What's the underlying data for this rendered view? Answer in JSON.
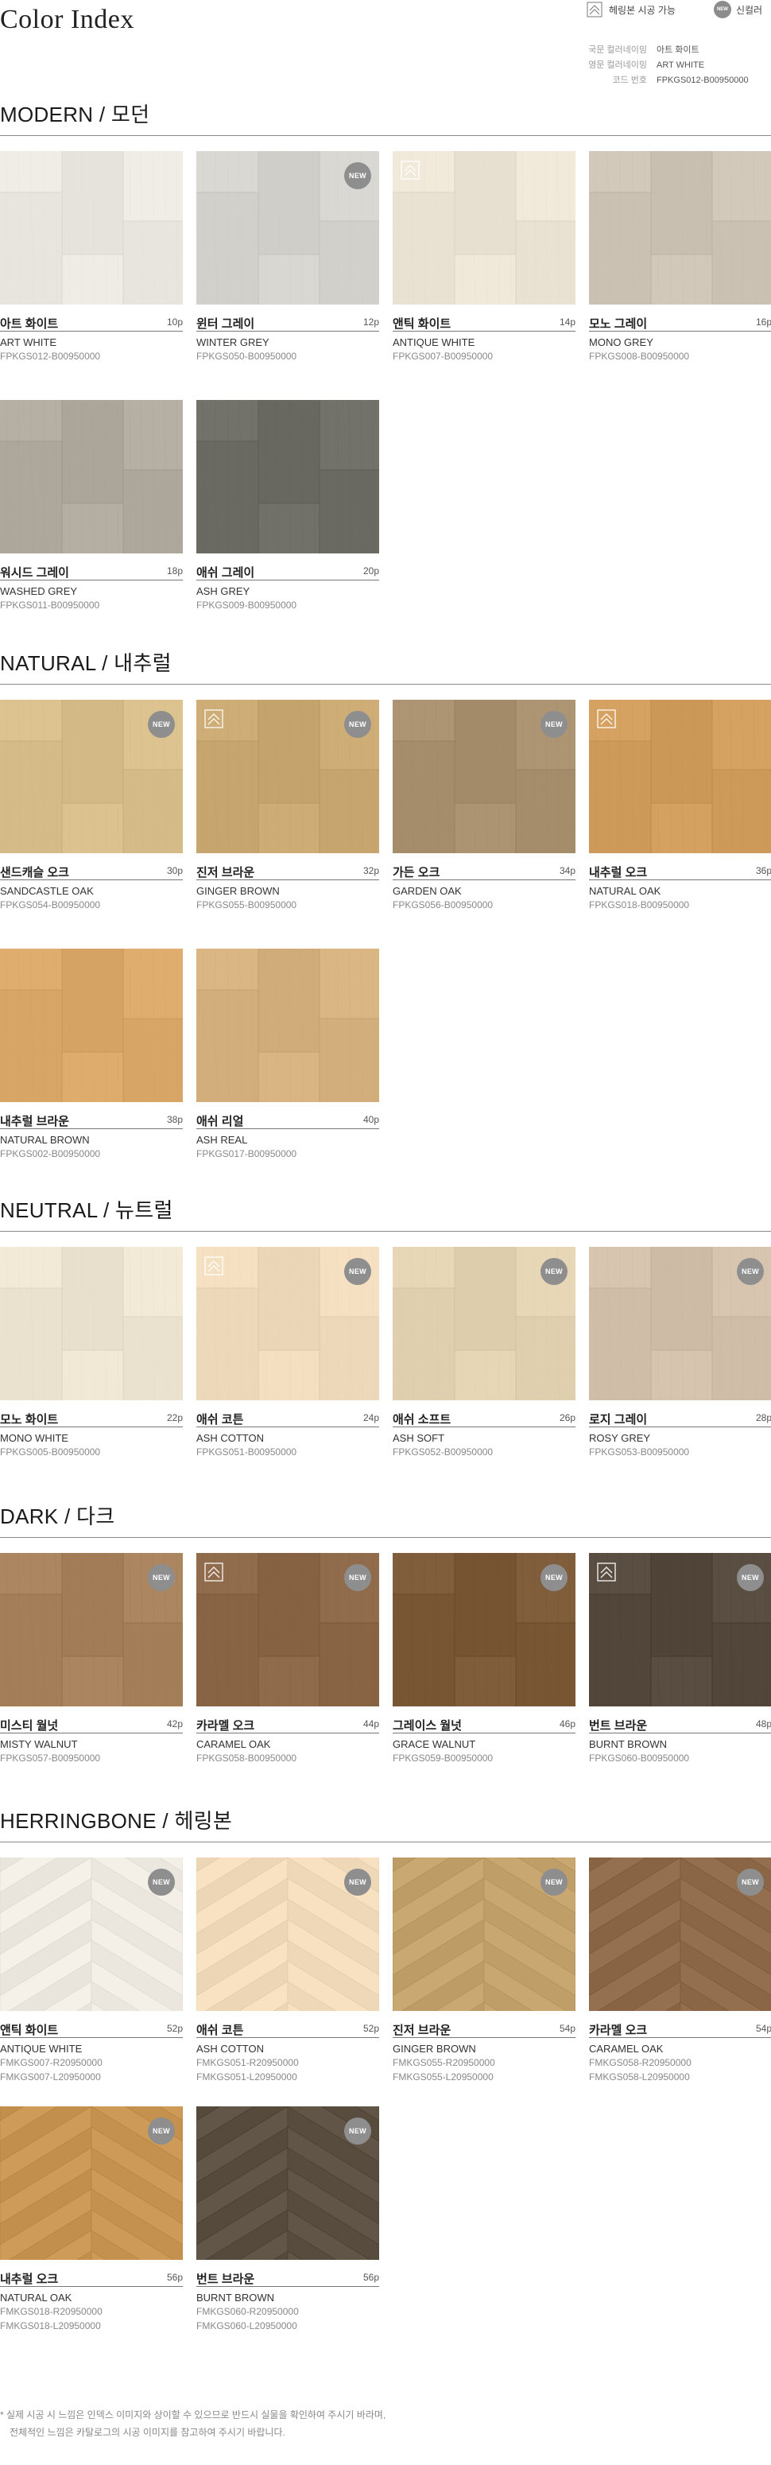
{
  "title": "Color Index",
  "legend": {
    "herringbone_label": "헤링본 시공 가능",
    "new_badge": "NEW",
    "new_label": "신컬러"
  },
  "key": [
    {
      "label": "국문 컬러네이밍",
      "value": "아트 화이트"
    },
    {
      "label": "영문 컬러네이밍",
      "value": "ART WHITE"
    },
    {
      "label": "코드 번호",
      "value": "FPKGS012-B00950000"
    }
  ],
  "colors": {
    "badge": "#8e8e8e",
    "rule": "#8a8a8a"
  },
  "badge_text": "NEW",
  "sections": [
    {
      "title": "MODERN / 모던",
      "items": [
        {
          "kname": "아트 화이트",
          "ename": "ART WHITE",
          "codes": [
            "FPKGS012-B00950000"
          ],
          "page": "10p",
          "new": false,
          "herringbone": false,
          "tone": "#ece8e2",
          "pattern": "plank"
        },
        {
          "kname": "윈터 그레이",
          "ename": "WINTER GREY",
          "codes": [
            "FPKGS050-B00950000"
          ],
          "page": "12p",
          "new": true,
          "herringbone": false,
          "tone": "#d6d4cf",
          "pattern": "plank"
        },
        {
          "kname": "앤틱 화이트",
          "ename": "ANTIQUE WHITE",
          "codes": [
            "FPKGS007-B00950000"
          ],
          "page": "14p",
          "new": false,
          "herringbone": true,
          "tone": "#ede5d5",
          "pattern": "plank"
        },
        {
          "kname": "모노 그레이",
          "ename": "MONO GREY",
          "codes": [
            "FPKGS008-B00950000"
          ],
          "page": "16p",
          "new": false,
          "herringbone": false,
          "tone": "#cfc5b6",
          "pattern": "plank"
        },
        {
          "kname": "워시드 그레이",
          "ename": "WASHED GREY",
          "codes": [
            "FPKGS011-B00950000"
          ],
          "page": "18p",
          "new": false,
          "herringbone": false,
          "tone": "#b2aba0",
          "pattern": "plank"
        },
        {
          "kname": "애쉬 그레이",
          "ename": "ASH GREY",
          "codes": [
            "FPKGS009-B00950000"
          ],
          "page": "20p",
          "new": false,
          "herringbone": false,
          "tone": "#6f6e66",
          "pattern": "plank"
        }
      ]
    },
    {
      "title": "NATURAL / 내추럴",
      "items": [
        {
          "kname": "샌드캐슬 오크",
          "ename": "SANDCASTLE OAK",
          "codes": [
            "FPKGS054-B00950000"
          ],
          "page": "30p",
          "new": true,
          "herringbone": false,
          "tone": "#d9bf8c",
          "pattern": "plank"
        },
        {
          "kname": "진저 브라운",
          "ename": "GINGER BROWN",
          "codes": [
            "FPKGS055-B00950000"
          ],
          "page": "32p",
          "new": true,
          "herringbone": true,
          "tone": "#caa972",
          "pattern": "plank"
        },
        {
          "kname": "가든 오크",
          "ename": "GARDEN OAK",
          "codes": [
            "FPKGS056-B00950000"
          ],
          "page": "34p",
          "new": true,
          "herringbone": false,
          "tone": "#a99170",
          "pattern": "plank"
        },
        {
          "kname": "내추럴 오크",
          "ename": "NATURAL OAK",
          "codes": [
            "FPKGS018-B00950000"
          ],
          "page": "36p",
          "new": false,
          "herringbone": true,
          "tone": "#d19e5d",
          "pattern": "plank"
        },
        {
          "kname": "내추럴 브라운",
          "ename": "NATURAL BROWN",
          "codes": [
            "FPKGS002-B00950000"
          ],
          "page": "38p",
          "new": false,
          "herringbone": false,
          "tone": "#dbaa6a",
          "pattern": "plank"
        },
        {
          "kname": "애쉬 리얼",
          "ename": "ASH REAL",
          "codes": [
            "FPKGS017-B00950000"
          ],
          "page": "40p",
          "new": false,
          "herringbone": false,
          "tone": "#d5b27f",
          "pattern": "plank"
        }
      ]
    },
    {
      "title": "NEUTRAL / 뉴트럴",
      "items": [
        {
          "kname": "모노 화이트",
          "ename": "MONO WHITE",
          "codes": [
            "FPKGS005-B00950000"
          ],
          "page": "22p",
          "new": false,
          "herringbone": false,
          "tone": "#eee6d3",
          "pattern": "plank"
        },
        {
          "kname": "애쉬 코튼",
          "ename": "ASH COTTON",
          "codes": [
            "FPKGS051-B00950000"
          ],
          "page": "24p",
          "new": true,
          "herringbone": true,
          "tone": "#f1dcbd",
          "pattern": "plank"
        },
        {
          "kname": "애쉬 소프트",
          "ename": "ASH SOFT",
          "codes": [
            "FPKGS052-B00950000"
          ],
          "page": "26p",
          "new": true,
          "herringbone": false,
          "tone": "#e4d3b3",
          "pattern": "plank"
        },
        {
          "kname": "로지 그레이",
          "ename": "ROSY GREY",
          "codes": [
            "FPKGS053-B00950000"
          ],
          "page": "28p",
          "new": true,
          "herringbone": false,
          "tone": "#d3c1ab",
          "pattern": "plank"
        }
      ]
    },
    {
      "title": "DARK / 다크",
      "items": [
        {
          "kname": "미스티 월넛",
          "ename": "MISTY WALNUT",
          "codes": [
            "FPKGS057-B00950000"
          ],
          "page": "42p",
          "new": true,
          "herringbone": false,
          "tone": "#a7825c",
          "pattern": "plank"
        },
        {
          "kname": "카라멜 오크",
          "ename": "CARAMEL OAK",
          "codes": [
            "FPKGS058-B00950000"
          ],
          "page": "44p",
          "new": true,
          "herringbone": true,
          "tone": "#8d6848",
          "pattern": "plank"
        },
        {
          "kname": "그레이스 월넛",
          "ename": "GRACE WALNUT",
          "codes": [
            "FPKGS059-B00950000"
          ],
          "page": "46p",
          "new": true,
          "herringbone": false,
          "tone": "#7c5a38",
          "pattern": "plank"
        },
        {
          "kname": "번트 브라운",
          "ename": "BURNT BROWN",
          "codes": [
            "FPKGS060-B00950000"
          ],
          "page": "48p",
          "new": true,
          "herringbone": true,
          "tone": "#564a3e",
          "pattern": "plank"
        }
      ]
    },
    {
      "title": "HERRINGBONE / 헤링본",
      "items": [
        {
          "kname": "앤틱 화이트",
          "ename": "ANTIQUE WHITE",
          "codes": [
            "FMKGS007-R20950000",
            "FMKGS007-L20950000"
          ],
          "page": "52p",
          "new": true,
          "herringbone": false,
          "tone": "#efebe2",
          "pattern": "herringbone"
        },
        {
          "kname": "애쉬 코튼",
          "ename": "ASH COTTON",
          "codes": [
            "FMKGS051-R20950000",
            "FMKGS051-L20950000"
          ],
          "page": "52p",
          "new": true,
          "herringbone": false,
          "tone": "#f2dcbb",
          "pattern": "herringbone"
        },
        {
          "kname": "진저 브라운",
          "ename": "GINGER BROWN",
          "codes": [
            "FMKGS055-R20950000",
            "FMKGS055-L20950000"
          ],
          "page": "54p",
          "new": true,
          "herringbone": false,
          "tone": "#c4a26c",
          "pattern": "herringbone"
        },
        {
          "kname": "카라멜 오크",
          "ename": "CARAMEL OAK",
          "codes": [
            "FMKGS058-R20950000",
            "FMKGS058-L20950000"
          ],
          "page": "54p",
          "new": true,
          "herringbone": false,
          "tone": "#8e6a4b",
          "pattern": "herringbone"
        },
        {
          "kname": "내추럴 오크",
          "ename": "NATURAL OAK",
          "codes": [
            "FMKGS018-R20950000",
            "FMKGS018-L20950000"
          ],
          "page": "56p",
          "new": true,
          "herringbone": false,
          "tone": "#c99553",
          "pattern": "herringbone"
        },
        {
          "kname": "번트 브라운",
          "ename": "BURNT BROWN",
          "codes": [
            "FMKGS060-R20950000",
            "FMKGS060-L20950000"
          ],
          "page": "56p",
          "new": true,
          "herringbone": false,
          "tone": "#5b5042",
          "pattern": "herringbone"
        }
      ]
    }
  ],
  "notes": [
    "* 실제 시공 시 느낌은 인덱스 이미지와 상이할 수 있으므로 반드시 실물을 확인하여 주시기 바라며,",
    "전체적인 느낌은 카탈로그의 시공 이미지를 참고하여 주시기 바랍니다."
  ]
}
